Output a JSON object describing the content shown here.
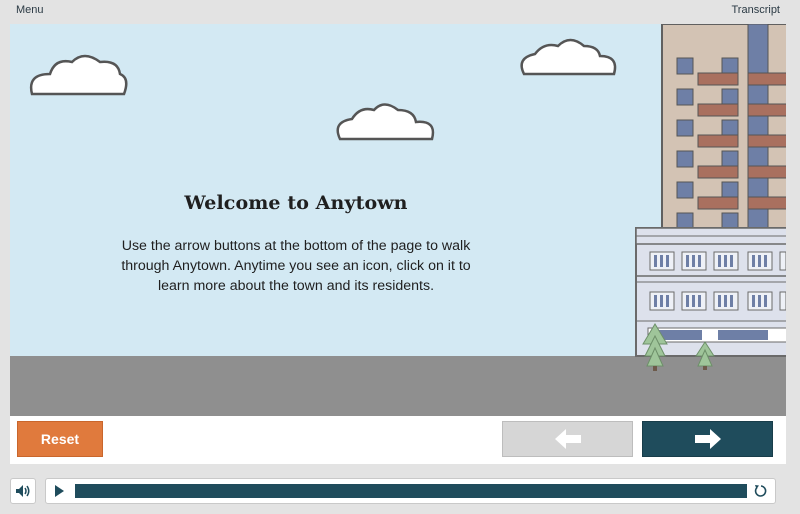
{
  "topbar": {
    "menu_label": "Menu",
    "transcript_label": "Transcript"
  },
  "scene": {
    "title": "Welcome to Anytown",
    "body": "Use the arrow buttons at the bottom of the page to walk through Anytown. Anytime you see an icon, click on it to learn more about the town and its residents.",
    "colors": {
      "sky": "#d3e9f3",
      "ground": "#8f8f8f",
      "tower": "#d3c3b4",
      "balcony": "#a9705f",
      "window": "#6e7fa6",
      "lower_building": "#dde1ec",
      "tree": "#9fc59a"
    }
  },
  "nav": {
    "reset_label": "Reset",
    "prev_icon": "arrow-left-icon",
    "next_icon": "arrow-right-icon",
    "colors": {
      "reset": "#e07a3d",
      "prev": "#d6d6d6",
      "next": "#1f4c5c"
    }
  },
  "player": {
    "volume_icon": "volume-icon",
    "play_icon": "play-icon",
    "replay_icon": "replay-icon",
    "progress": 1.0,
    "colors": {
      "progress": "#1f4c5c"
    }
  }
}
